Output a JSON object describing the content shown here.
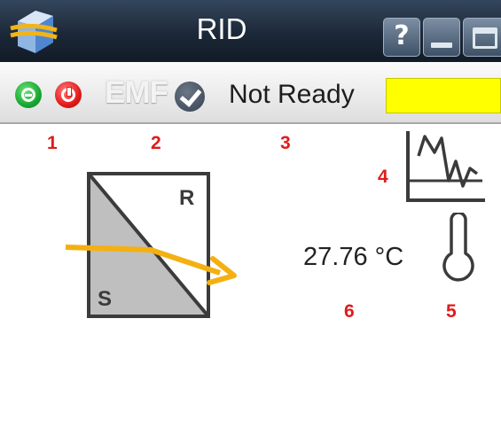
{
  "window": {
    "title": "RID",
    "help_label": "?",
    "icons": [
      "app-icon",
      "help-icon",
      "minimize-icon",
      "maximize-icon"
    ]
  },
  "toolbar": {
    "emf_label": "EMF",
    "status_text": "Not Ready",
    "status_color": "#ffff00",
    "icons": [
      "standby-icon",
      "power-icon",
      "check-icon"
    ]
  },
  "callouts": [
    "1",
    "2",
    "3",
    "4",
    "5",
    "6"
  ],
  "detector": {
    "sample_label": "S",
    "reference_label": "R",
    "beam_color": "#f4b012"
  },
  "temperature": {
    "value": "27.76 °C"
  }
}
